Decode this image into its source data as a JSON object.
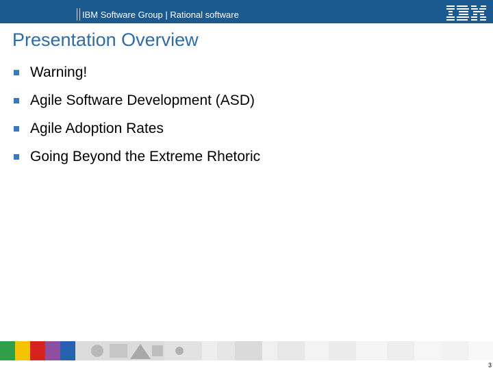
{
  "header": {
    "text": "IBM Software Group | Rational software",
    "logo_text": "IBM"
  },
  "title": "Presentation Overview",
  "bullets": [
    {
      "text": "Warning!"
    },
    {
      "text": "Agile Software Development (ASD)"
    },
    {
      "text": "Agile Adoption Rates"
    },
    {
      "text": "Going Beyond the Extreme Rhetoric"
    }
  ],
  "footer": {
    "page_number": "3"
  },
  "colors": {
    "header_bar": "#1b5a91",
    "title": "#2d6ca8",
    "bullet_marker": "#3a7bbf",
    "footer_blocks": [
      "#2f9f4a",
      "#f4c400",
      "#d8221e",
      "#8e4fa0",
      "#2563b0"
    ]
  }
}
